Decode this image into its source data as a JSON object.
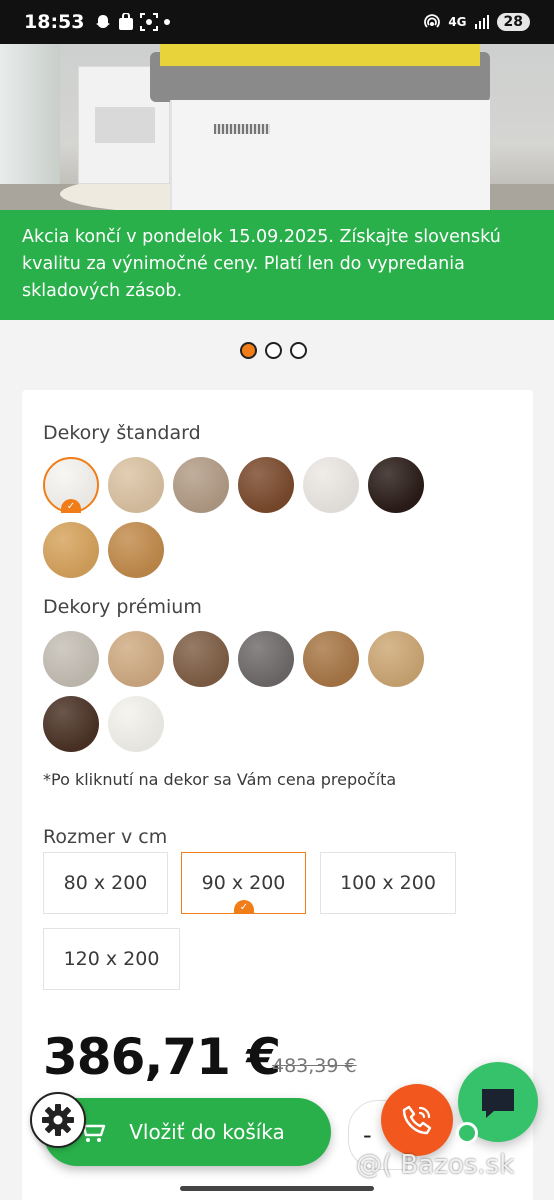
{
  "status_bar": {
    "time": "18:53",
    "network": "4G",
    "battery": "28",
    "icons": [
      "snapchat-icon",
      "bag-icon",
      "screenshot-icon",
      "dot-icon",
      "hotspot-icon",
      "signal-icon"
    ]
  },
  "promo": {
    "text": "Akcia končí v pondelok 15.09.2025. Získajte slovenskú kvalitu za výnimočné ceny. Platí len do vypredania skladových zásob.",
    "color": "#2ab04a"
  },
  "carousel": {
    "slides": 3,
    "active_index": 0
  },
  "decors_standard": {
    "title": "Dekory štandard",
    "swatches": [
      {
        "color": "#f7f5f1",
        "selected": true
      },
      {
        "color": "#dcc3a3"
      },
      {
        "color": "#b39c86"
      },
      {
        "color": "#7a4a2c"
      },
      {
        "color": "#ece8e4"
      },
      {
        "color": "#2a1c17"
      },
      {
        "color": "#d7a35c"
      },
      {
        "color": "#c28b4b"
      }
    ]
  },
  "decors_premium": {
    "title": "Dekory prémium",
    "swatches": [
      {
        "color": "#c5bfb5"
      },
      {
        "color": "#d0ab82"
      },
      {
        "color": "#7f5e45"
      },
      {
        "color": "#6f6a6a"
      },
      {
        "color": "#a87746"
      },
      {
        "color": "#cda774"
      },
      {
        "color": "#4a3124"
      },
      {
        "color": "#f4f2ec"
      }
    ]
  },
  "note": "*Po kliknutí na dekor sa Vám cena prepočíta",
  "size": {
    "title": "Rozmer v cm",
    "options": [
      "80 x 200",
      "90 x 200",
      "100 x 200",
      "120 x 200"
    ],
    "selected": "90 x 200"
  },
  "price": {
    "current": "386,71 €",
    "old": "483,39 €"
  },
  "cart": {
    "label": "Vložiť do košíka",
    "qty_symbol": "-"
  },
  "watermark": "@( Bazos.sk",
  "colors": {
    "accent": "#f07d18",
    "green": "#2ab04a",
    "call": "#f2581e"
  }
}
